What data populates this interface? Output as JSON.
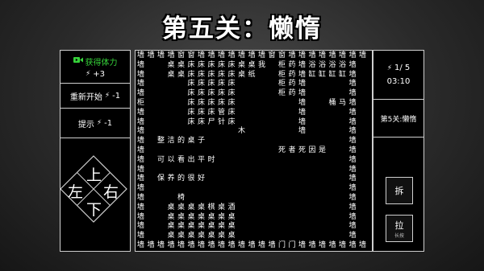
{
  "title": "第五关：懒惰",
  "left_panel": {
    "reward": {
      "label": "获得体力",
      "icon": "video-icon",
      "amount": "+3"
    },
    "restart": {
      "label": "重新开始",
      "cost": "-1"
    },
    "hint": {
      "label": "提示",
      "cost": "-1"
    },
    "dpad": {
      "up": "上",
      "down": "下",
      "left": "左",
      "right": "右"
    }
  },
  "right_panel": {
    "stamina": "1/ 5",
    "timer": "03:10",
    "level_name": "第5关:懒惰",
    "demolish_button": "拆",
    "pull_button": "拉",
    "pull_sub": "长按"
  },
  "grid_lines": [
    "墙墙墙墙窗窗墙墙墙墙墙墙墙窗窗墙墙墙墙墙墙墙墙",
    "墙　　桌桌床床床床床桌桌我　柜药墙浴浴浴浴墙",
    "墙　　桌桌床床床床床桌纸　　柜药墙缸缸缸缸墙",
    "墙　　　　床床床床床　　　　柜药墙　　　　墙",
    "墙　　　　床床床床床　　　　柜药墙　　　　墙",
    "柜　　　　床床床床床　　　　　　墙　　桶马墙",
    "墙　　　　床床床管床　　　　　　墙　　　　墙",
    "墙　　　　床床尸针床　　　　　　墙　　　　墙",
    "墙　　　　　　　　　木　　　　　墙　　　　墙",
    "墙　整洁的桌子　　　　　　　　　　　　　　墙",
    "墙　　　　　　　　　　　　　死者死因是　　墙",
    "墙　可以看出平时　　　　　　　　　　　　　墙",
    "墙　　　　　　　　　　　　　　　　　　　　墙",
    "墙　保养的很好　　　　　　　　　　　　　　墙",
    "墙　　　　　　　　　　　　　　　　　　　　墙",
    "墙　　　椅　　　　　　　　　　　　　　　　墙",
    "墙　　桌桌桌桌棋桌酒　　　　　　　　　　　墙",
    "墙　　桌桌桌桌桌桌桌　　　　　　　　　　　墙",
    "墙　　桌桌桌桌桌桌桌　　　　　　　　　　　墙",
    "墙　　桌桌桌桌桌桌桌　　　　　　　　　　　墙",
    "墙墙墙墙墙墙墙墙墙墙墙墙墙墙门门墙墙墙墙墙墙墙"
  ]
}
